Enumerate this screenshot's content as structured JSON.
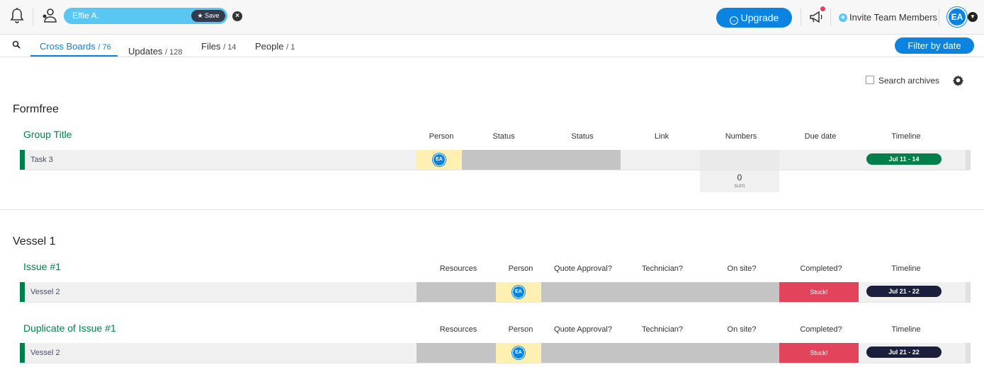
{
  "topbar": {
    "filter_chip": {
      "name": "Effie A.",
      "save_label": "Save"
    },
    "upgrade_label": "Upgrade",
    "invite_label": "Invite Team Members",
    "avatar_initials": "EA",
    "icons": [
      "bell-icon",
      "person-filter-icon",
      "close-icon",
      "megaphone-icon",
      "plus-icon",
      "caret-down-icon"
    ]
  },
  "tabs": [
    {
      "label": "Cross Boards",
      "count": "/ 76",
      "active": true
    },
    {
      "label": "Updates",
      "count": "/ 128",
      "active": false
    },
    {
      "label": "Files",
      "count": "/ 14",
      "active": false
    },
    {
      "label": "People",
      "count": "/ 1",
      "active": false
    }
  ],
  "filter_date_label": "Filter by date",
  "search_archives_label": "Search archives",
  "boards": [
    {
      "title": "Formfree",
      "groups": [
        {
          "title": "Group Title",
          "columns": [
            "Person",
            "Status",
            "Status",
            "Link",
            "Numbers",
            "Due date",
            "Timeline"
          ],
          "rows": [
            {
              "name": "Task 3",
              "person": "EA",
              "timeline": "Jul 11 - 14"
            }
          ],
          "summary": {
            "value": "0",
            "label": "sum"
          }
        }
      ]
    },
    {
      "title": "Vessel 1",
      "groups": [
        {
          "title": "Issue #1",
          "columns": [
            "Resources",
            "Person",
            "Quote Approval?",
            "Technician?",
            "On site?",
            "Completed?",
            "Timeline"
          ],
          "rows": [
            {
              "name": "Vessel 2",
              "person": "EA",
              "completed": "Stuck!",
              "timeline": "Jul 21 - 22"
            }
          ]
        },
        {
          "title": "Duplicate of Issue #1",
          "columns": [
            "Resources",
            "Person",
            "Quote Approval?",
            "Technician?",
            "On site?",
            "Completed?",
            "Timeline"
          ],
          "rows": [
            {
              "name": "Vessel 2",
              "person": "EA",
              "completed": "Stuck!",
              "timeline": "Jul 21 - 22"
            }
          ]
        }
      ]
    }
  ],
  "colors": {
    "primary": "#0a84e0",
    "group_green": "#037f4c",
    "stuck_red": "#e2445c",
    "timeline_green": "#037f4c",
    "timeline_dark": "#1c1f3b",
    "person_cell_yellow": "#fdf0b2",
    "empty_cell_gray": "#c4c4c4"
  }
}
